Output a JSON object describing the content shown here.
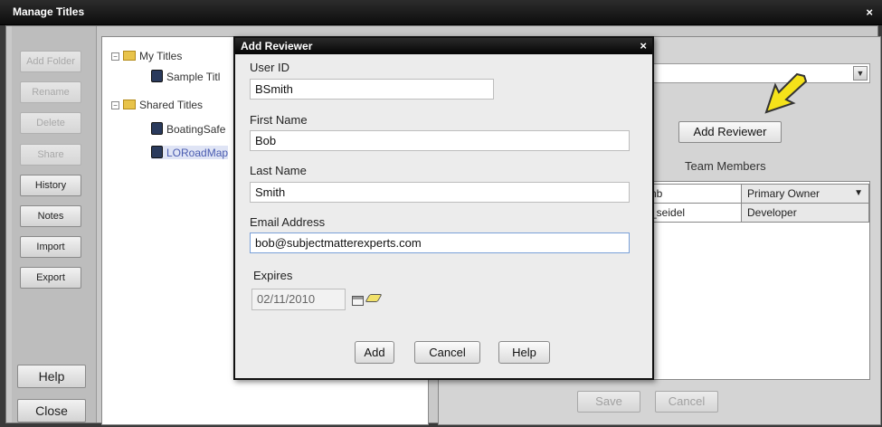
{
  "window": {
    "title": "Manage Titles",
    "close": "×"
  },
  "left_buttons": {
    "add_folder": "Add Folder",
    "rename": "Rename",
    "delete": "Delete",
    "share": "Share",
    "history": "History",
    "notes": "Notes",
    "import": "Import",
    "export": "Export",
    "help": "Help",
    "close": "Close"
  },
  "tree": {
    "my_titles": "My Titles",
    "sample_title": "Sample Titl",
    "shared_titles": "Shared Titles",
    "boating": "BoatingSafe",
    "loroadmap": "LORoadMap",
    "expand_glyph": "−"
  },
  "right": {
    "add_reviewer_button": "Add Reviewer",
    "team_members_label": "Team Members",
    "table": {
      "rows": [
        {
          "name": "nb",
          "role": "Primary Owner"
        },
        {
          "name": "_seidel",
          "role": "Developer"
        }
      ]
    },
    "save": "Save",
    "cancel": "Cancel",
    "arrow_color": "#f5e21a"
  },
  "modal": {
    "title": "Add Reviewer",
    "close": "×",
    "user_id_label": "User ID",
    "user_id_value": "BSmith",
    "first_name_label": "First Name",
    "first_name_value": "Bob",
    "last_name_label": "Last Name",
    "last_name_value": "Smith",
    "email_label": "Email Address",
    "email_value": "bob@subjectmatterexperts.com",
    "expires_label": "Expires",
    "expires_value": "02/11/2010",
    "add": "Add",
    "cancel": "Cancel",
    "help": "Help"
  }
}
